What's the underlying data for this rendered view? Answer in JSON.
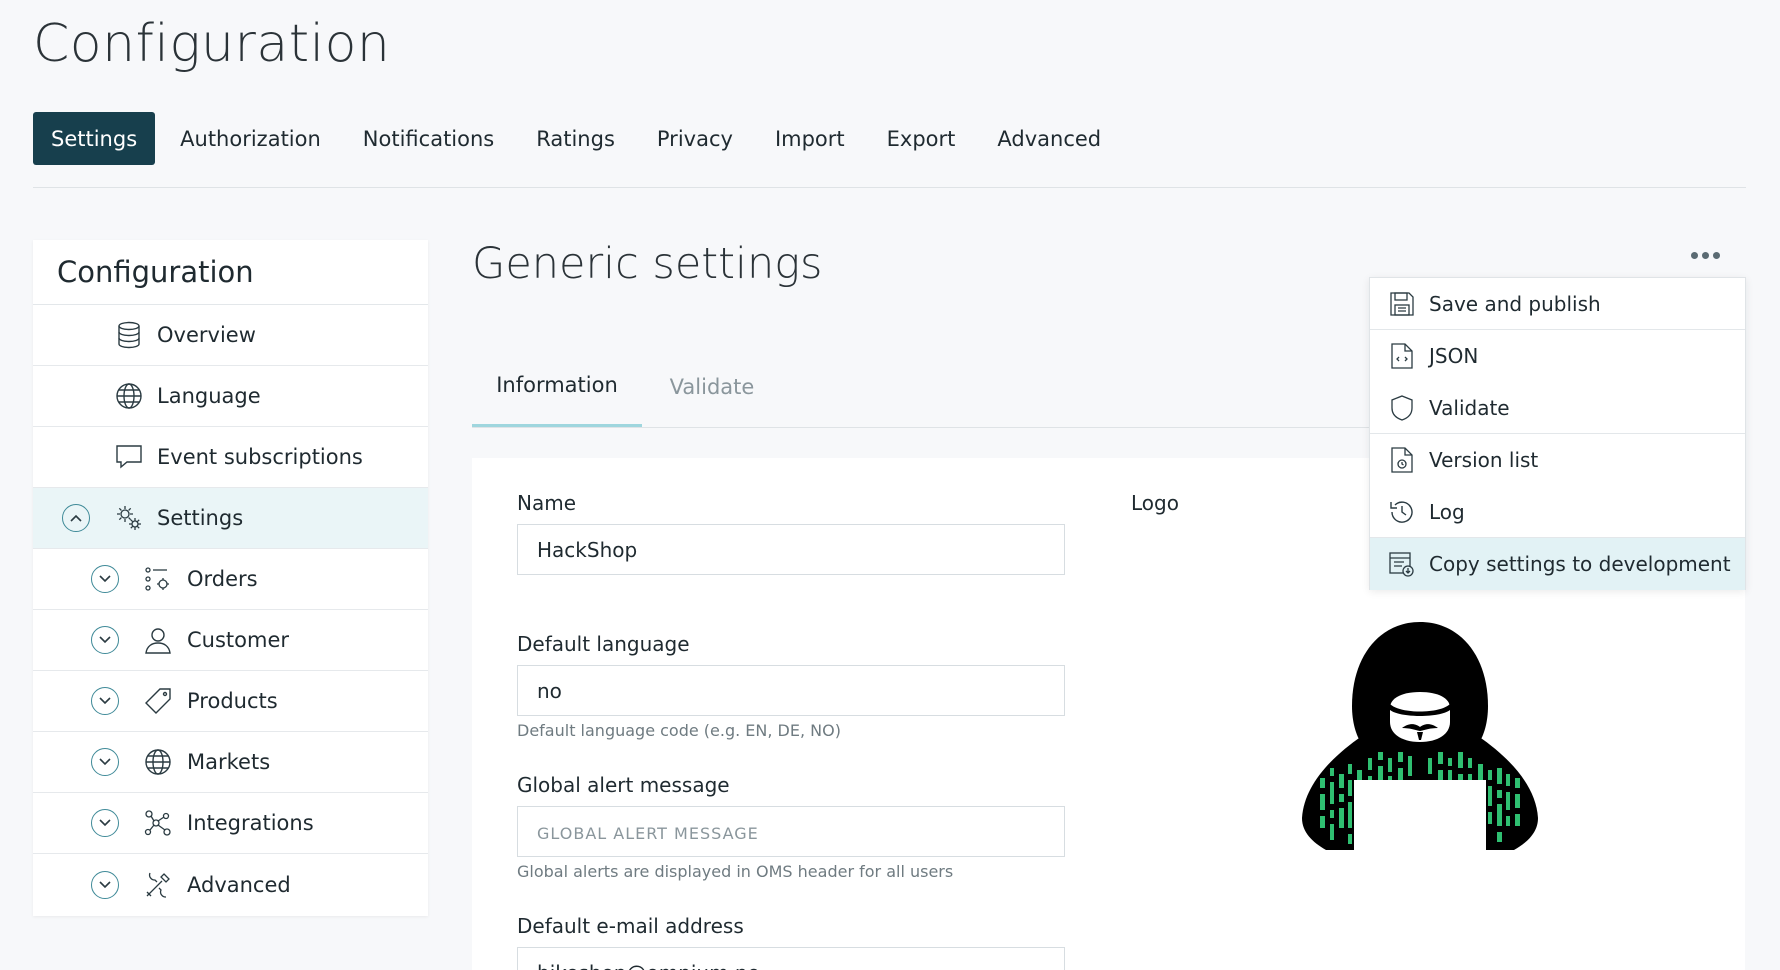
{
  "page": {
    "title": "Configuration"
  },
  "top_tabs": [
    "Settings",
    "Authorization",
    "Notifications",
    "Ratings",
    "Privacy",
    "Import",
    "Export",
    "Advanced"
  ],
  "sidebar": {
    "title": "Configuration",
    "items": [
      {
        "label": "Overview",
        "icon": "database-icon"
      },
      {
        "label": "Language",
        "icon": "globe-icon"
      },
      {
        "label": "Event subscriptions",
        "icon": "chat-icon"
      },
      {
        "label": "Settings",
        "icon": "gears-icon",
        "expanded": true
      },
      {
        "label": "Orders",
        "icon": "list-gear-icon"
      },
      {
        "label": "Customer",
        "icon": "user-icon"
      },
      {
        "label": "Products",
        "icon": "tag-icon"
      },
      {
        "label": "Markets",
        "icon": "globe-icon"
      },
      {
        "label": "Integrations",
        "icon": "nodes-icon"
      },
      {
        "label": "Advanced",
        "icon": "tools-icon"
      }
    ]
  },
  "content": {
    "title": "Generic settings",
    "tabs": [
      "Information",
      "Validate"
    ]
  },
  "form": {
    "name_label": "Name",
    "name_value": "HackShop",
    "logo_label": "Logo",
    "language_label": "Default language",
    "language_value": "no",
    "language_help": "Default language code (e.g. EN, DE, NO)",
    "alert_label": "Global alert message",
    "alert_placeholder": "GLOBAL ALERT MESSAGE",
    "alert_help": "Global alerts are displayed in OMS header for all users",
    "email_label": "Default e-mail address",
    "email_value": "bikeshop@omnium.no"
  },
  "menu": {
    "items": [
      {
        "label": "Save and publish",
        "icon": "save-icon"
      },
      {
        "label": "JSON",
        "icon": "json-file-icon"
      },
      {
        "label": "Validate",
        "icon": "shield-icon"
      },
      {
        "label": "Version list",
        "icon": "version-file-icon"
      },
      {
        "label": "Log",
        "icon": "history-icon"
      },
      {
        "label": "Copy settings to development",
        "icon": "copy-settings-icon"
      }
    ]
  },
  "colors": {
    "active_tab": "#173f4d",
    "accent": "#9fd6de",
    "highlight": "#e2f2f5",
    "logo_green": "#2fbf71"
  }
}
